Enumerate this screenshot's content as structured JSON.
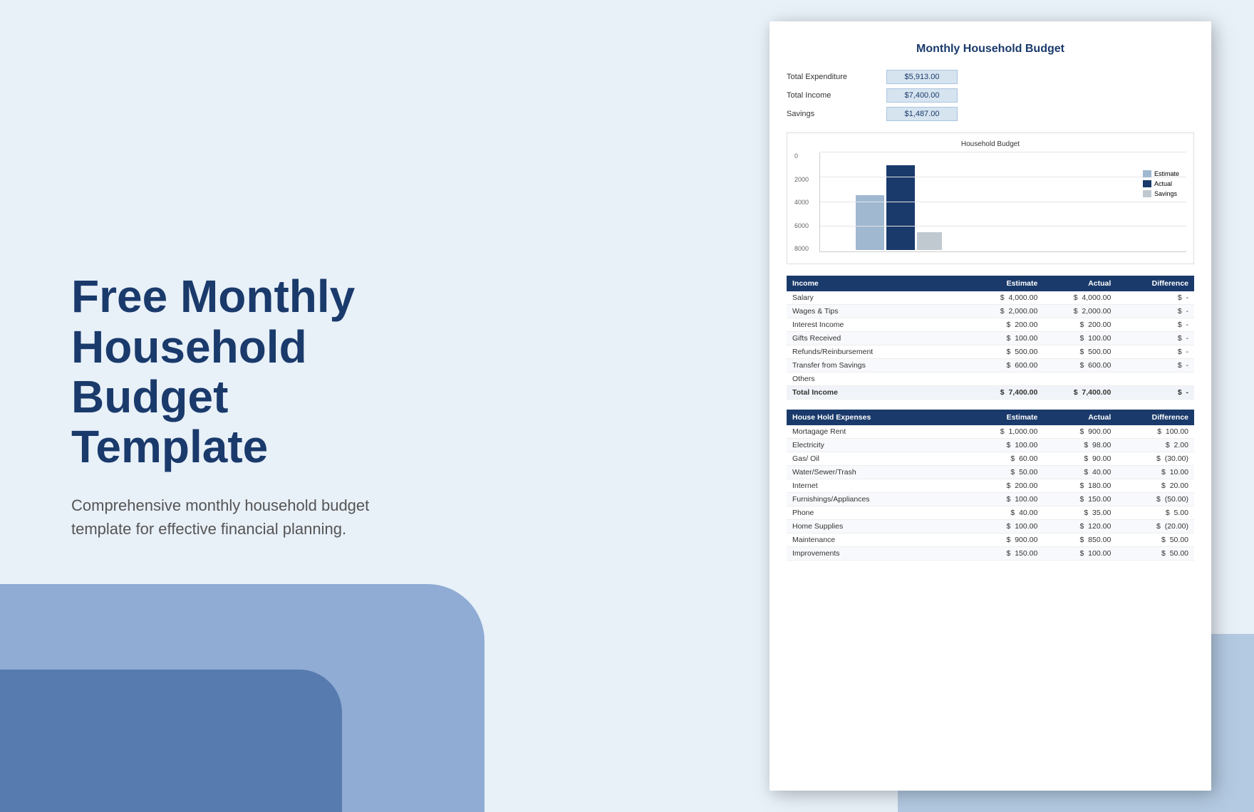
{
  "background": {
    "color": "#e8f0f8"
  },
  "left": {
    "title_line1": "Free Monthly Household",
    "title_line2": "Budget Template",
    "subtitle": "Comprehensive monthly household budget template for effective financial planning."
  },
  "document": {
    "title": "Monthly Household Budget",
    "summary": {
      "labels": [
        "Total Expenditure",
        "Total Income",
        "Savings"
      ],
      "values": [
        "$5,913.00",
        "$7,400.00",
        "$1,487.00"
      ]
    },
    "chart": {
      "title": "Household Budget",
      "y_labels": [
        "8000",
        "6000",
        "4000",
        "2000",
        "0"
      ],
      "legend": [
        {
          "label": "Estimate",
          "color": "#a0b8d0"
        },
        {
          "label": "Actual",
          "color": "#1a3a6b"
        },
        {
          "label": "Savings",
          "color": "#c0c8d0"
        }
      ],
      "bars": {
        "estimate_height_pct": 55,
        "actual_height_pct": 85,
        "savings_height_pct": 18
      }
    },
    "income_table": {
      "header": [
        "Income",
        "Estimate",
        "Actual",
        "Difference"
      ],
      "rows": [
        [
          "Salary",
          "$ 4,000.00",
          "$ 4,000.00",
          "$ -"
        ],
        [
          "Wages & Tips",
          "$ 2,000.00",
          "$ 2,000.00",
          "$ -"
        ],
        [
          "Interest Income",
          "$ 200.00",
          "$ 200.00",
          "$ -"
        ],
        [
          "Gifts Received",
          "$ 100.00",
          "$ 100.00",
          "$ -"
        ],
        [
          "Refunds/Reinbursement",
          "$ 500.00",
          "$ 500.00",
          "$ -"
        ],
        [
          "Transfer from Savings",
          "$ 600.00",
          "$ 600.00",
          "$ -"
        ],
        [
          "Others",
          "",
          "",
          ""
        ]
      ],
      "total_row": [
        "Total Income",
        "$ 7,400.00",
        "$ 7,400.00",
        "$ -"
      ]
    },
    "expenses_table": {
      "header": [
        "House Hold Expenses",
        "Estimate",
        "Actual",
        "Difference"
      ],
      "rows": [
        [
          "Mortagage Rent",
          "$ 1,000.00",
          "$ 900.00",
          "$ 100.00"
        ],
        [
          "Electricity",
          "$ 100.00",
          "$ 98.00",
          "$ 2.00"
        ],
        [
          "Gas/ Oil",
          "$ 60.00",
          "$ 90.00",
          "$ (30.00)"
        ],
        [
          "Water/Sewer/Trash",
          "$ 50.00",
          "$ 40.00",
          "$ 10.00"
        ],
        [
          "Internet",
          "$ 200.00",
          "$ 180.00",
          "$ 20.00"
        ],
        [
          "Furnishings/Appliances",
          "$ 100.00",
          "$ 150.00",
          "$ (50.00)"
        ],
        [
          "Phone",
          "$ 40.00",
          "$ 35.00",
          "$ 5.00"
        ],
        [
          "Home Supplies",
          "$ 100.00",
          "$ 120.00",
          "$ (20.00)"
        ],
        [
          "Maintenance",
          "$ 900.00",
          "$ 850.00",
          "$ 50.00"
        ],
        [
          "Improvements",
          "$ 150.00",
          "$ 100.00",
          "$ 50.00"
        ]
      ]
    }
  }
}
